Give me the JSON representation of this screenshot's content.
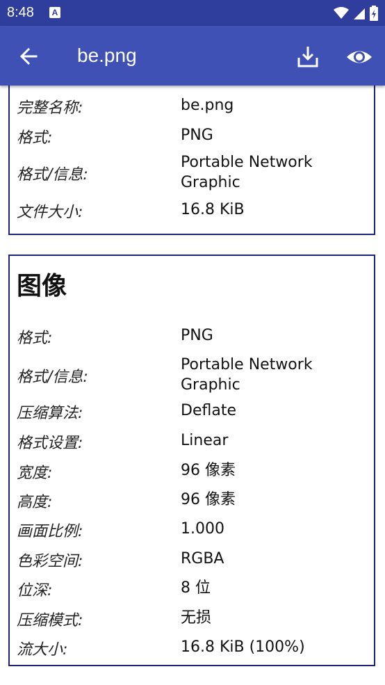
{
  "status_bar": {
    "time": "8:48",
    "app_icon": "A"
  },
  "app_bar": {
    "title": "be.png"
  },
  "file_section": {
    "rows": [
      {
        "label": "完整名称:",
        "value": "be.png"
      },
      {
        "label": "格式:",
        "value": "PNG"
      },
      {
        "label": "格式/信息:",
        "value": "Portable Network Graphic"
      },
      {
        "label": "文件大小:",
        "value": "16.8 KiB"
      }
    ]
  },
  "image_section": {
    "heading": "图像",
    "rows": [
      {
        "label": "格式:",
        "value": "PNG"
      },
      {
        "label": "格式/信息:",
        "value": "Portable Network Graphic"
      },
      {
        "label": "压缩算法:",
        "value": "Deflate"
      },
      {
        "label": "格式设置:",
        "value": "Linear"
      },
      {
        "label": "宽度:",
        "value": "96 像素"
      },
      {
        "label": "高度:",
        "value": "96 像素"
      },
      {
        "label": "画面比例:",
        "value": "1.000"
      },
      {
        "label": "色彩空间:",
        "value": "RGBA"
      },
      {
        "label": "位深:",
        "value": "8 位"
      },
      {
        "label": "压缩模式:",
        "value": "无损"
      },
      {
        "label": "流大小:",
        "value": "16.8 KiB (100%)"
      }
    ]
  },
  "colors": {
    "status_bar": "#2f3d9c",
    "app_bar": "#3f51b5",
    "card_border": "#1a237e"
  }
}
